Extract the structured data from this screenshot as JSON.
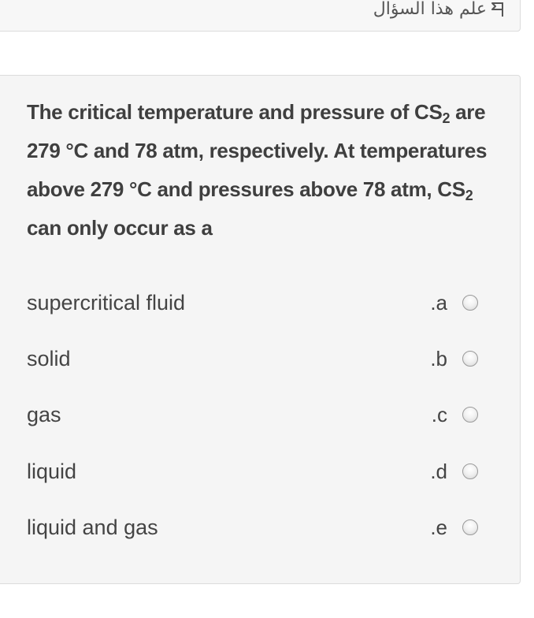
{
  "flag": {
    "icon": "flag-outline-icon",
    "label": "علم هذا السؤال"
  },
  "question": {
    "parts": [
      "The critical temperature and pressure of CS",
      "2",
      " are 279 °C and 78 atm, respectively. At temperatures above 279 °C and pressures above 78 atm, CS",
      "2",
      " can only occur as a"
    ]
  },
  "answers": [
    {
      "letter": ".a",
      "text": "supercritical fluid",
      "selected": false
    },
    {
      "letter": ".b",
      "text": "solid",
      "selected": false
    },
    {
      "letter": ".c",
      "text": "gas",
      "selected": false
    },
    {
      "letter": ".d",
      "text": "liquid",
      "selected": false
    },
    {
      "letter": ".e",
      "text": "liquid and gas",
      "selected": false
    }
  ]
}
